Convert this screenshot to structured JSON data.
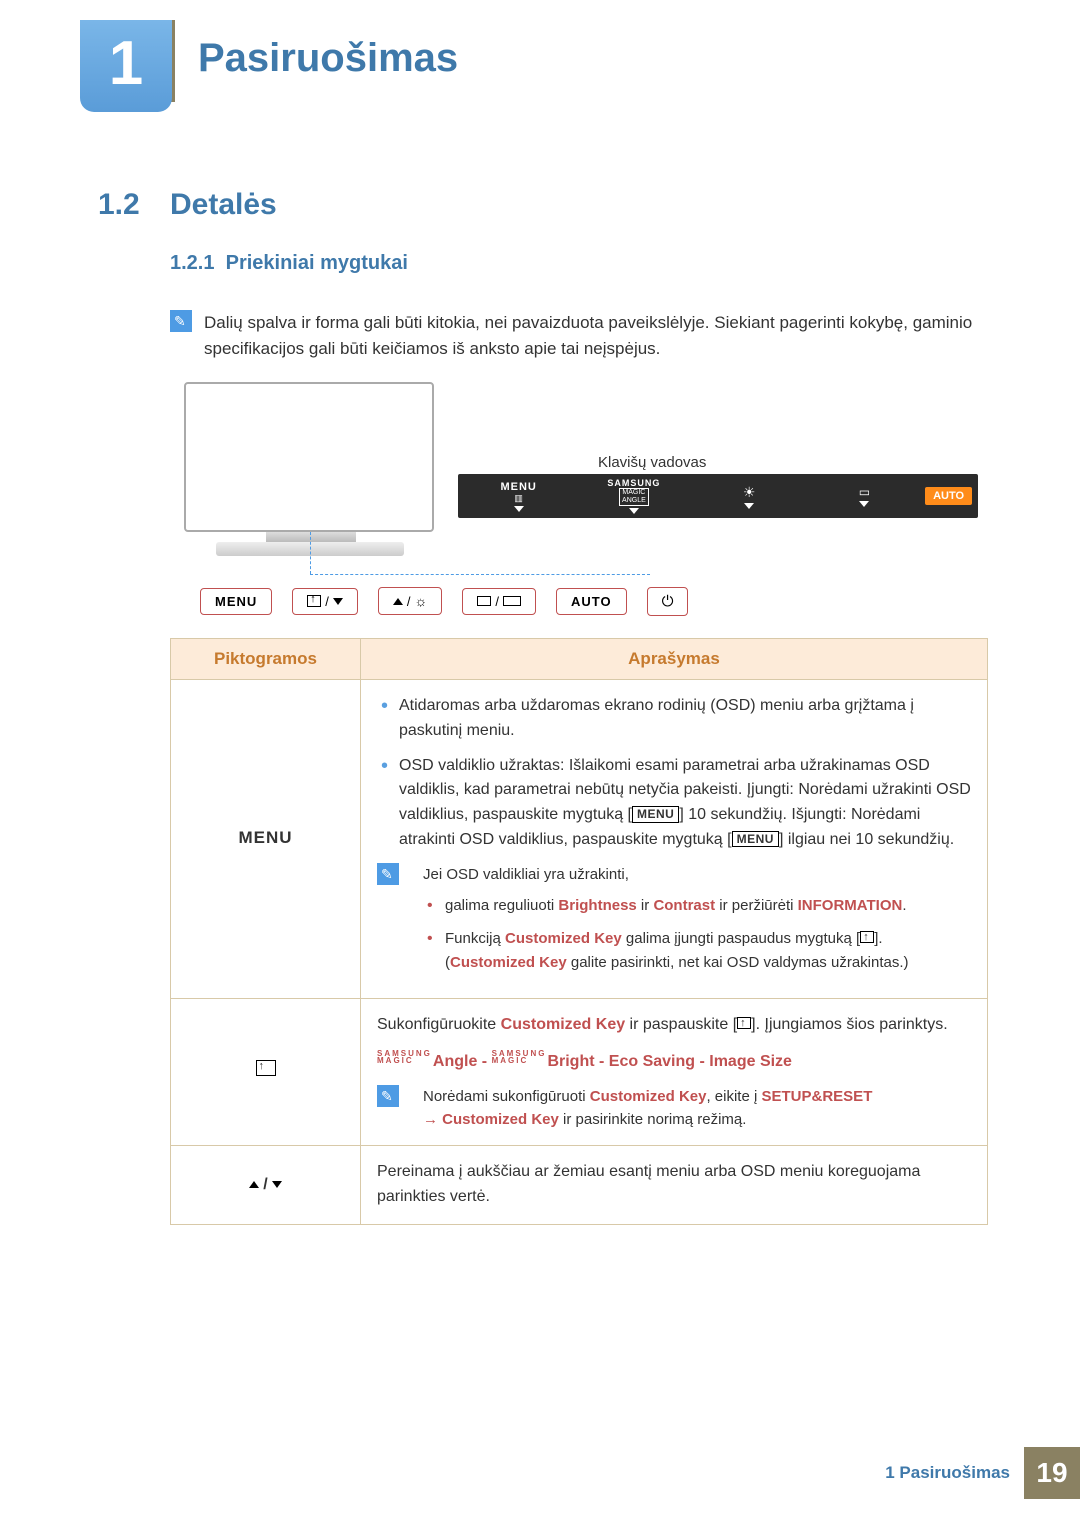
{
  "chapter": {
    "number": "1",
    "title": "Pasiruošimas"
  },
  "section": {
    "number": "1.2",
    "title": "Detalės"
  },
  "subsection": {
    "number": "1.2.1",
    "title": "Priekiniai mygtukai"
  },
  "intro_note": "Dalių spalva ir forma gali būti kitokia, nei pavaizduota paveikslėlyje. Siekiant pagerinti kokybę, gaminio specifikacijos gali būti keičiamos iš anksto apie tai neįspėjus.",
  "key_guide_label": "Klavišų vadovas",
  "key_guide": {
    "menu": "MENU",
    "samsung": "SAMSUNG",
    "magic": "MAGIC",
    "angle": "ANGLE",
    "auto": "AUTO"
  },
  "buttons": {
    "menu": "MENU",
    "auto": "AUTO"
  },
  "table": {
    "headers": {
      "icons": "Piktogramos",
      "description": "Aprašymas"
    },
    "row_menu": {
      "icon_label": "MENU",
      "bullet_open": "Atidaromas arba uždaromas ekrano rodinių (OSD) meniu arba grįžtama į paskutinį meniu.",
      "bullet_lock_pre": "OSD valdiklio užraktas: Išlaikomi esami parametrai arba užrakinamas OSD valdiklis, kad parametrai nebūtų netyčia pakeisti. Įjungti: Norėdami užrakinti OSD valdiklius, paspauskite mygtuką [",
      "bullet_lock_mid": "] 10 sekundžių. Išjungti: Norėdami atrakinti OSD valdiklius, paspauskite mygtuką [",
      "bullet_lock_end": "] ilgiau nei 10 sekundžių.",
      "note_intro": "Jei OSD valdikliai yra užrakinti,",
      "sub1_pre": "galima reguliuoti ",
      "brightness": "Brightness",
      "and": " ir ",
      "contrast": "Contrast",
      "sub1_post": " ir peržiūrėti ",
      "information": "INFORMATION",
      "sub2_pre": "Funkciją ",
      "customized_key": "Customized Key",
      "sub2_mid": " galima įjungti paspaudus mygtuką [",
      "sub2_mid2": "]. (",
      "sub2_post": " galite pasirinkti, net kai OSD valdymas užrakintas.)"
    },
    "row_custom": {
      "line1_pre": "Sukonfigūruokite ",
      "line1_mid": " ir paspauskite [",
      "line1_post": "]. Įjungiamos šios parinktys.",
      "opt_angle": "Angle",
      "opt_bright": "Bright",
      "opt_eco": "Eco Saving",
      "opt_size": "Image Size",
      "sep": " - ",
      "note_pre": "Norėdami sukonfigūruoti ",
      "note_mid": ", eikite į ",
      "setup": "SETUP&RESET",
      "note_arrow": " → ",
      "note_post": " ir pasirinkite norimą režimą."
    },
    "row_nav": {
      "text": "Pereinama į aukščiau ar žemiau esantį meniu arba OSD meniu koreguojama parinkties vertė."
    }
  },
  "footer": {
    "text": "1 Pasiruošimas",
    "page": "19"
  }
}
